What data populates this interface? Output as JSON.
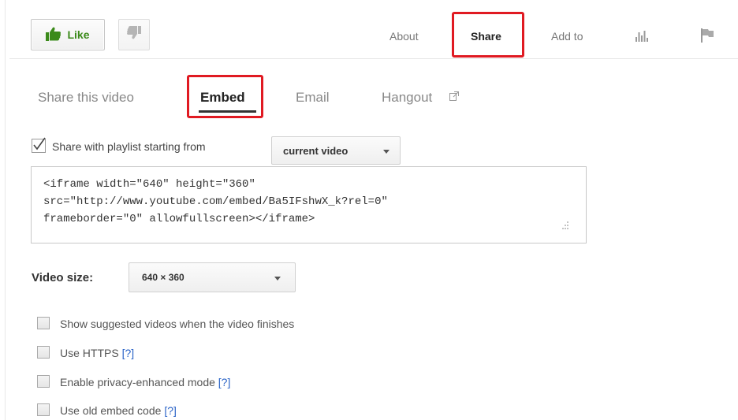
{
  "topbar": {
    "like_label": "Like",
    "tabs": [
      {
        "label": "About",
        "active": false
      },
      {
        "label": "Share",
        "active": true
      },
      {
        "label": "Add to",
        "active": false
      }
    ],
    "icons": [
      "thumbs-up-icon",
      "thumbs-down-icon",
      "statistics-icon",
      "flag-icon"
    ]
  },
  "share_tabs": [
    {
      "label": "Share this video",
      "active": false
    },
    {
      "label": "Embed",
      "active": true
    },
    {
      "label": "Email",
      "active": false
    },
    {
      "label": "Hangout",
      "active": false
    }
  ],
  "playlist": {
    "checked": true,
    "label": "Share with playlist starting from",
    "selected": "current video"
  },
  "embed_code": "<iframe width=\"640\" height=\"360\"\nsrc=\"http://www.youtube.com/embed/Ba5IFshwX_k?rel=0\"\nframeborder=\"0\" allowfullscreen></iframe>",
  "video_size": {
    "label": "Video size:",
    "selected": "640 × 360"
  },
  "options": [
    {
      "label": "Show suggested videos when the video finishes",
      "help": "",
      "checked": false
    },
    {
      "label": "Use HTTPS",
      "help": "[?]",
      "checked": false
    },
    {
      "label": "Enable privacy-enhanced mode",
      "help": "[?]",
      "checked": false
    },
    {
      "label": "Use old embed code",
      "help": "[?]",
      "checked": false
    }
  ],
  "colors": {
    "highlight_border": "#e01a22",
    "like_green": "#3b8a1a",
    "help_link": "#2a63c7"
  }
}
